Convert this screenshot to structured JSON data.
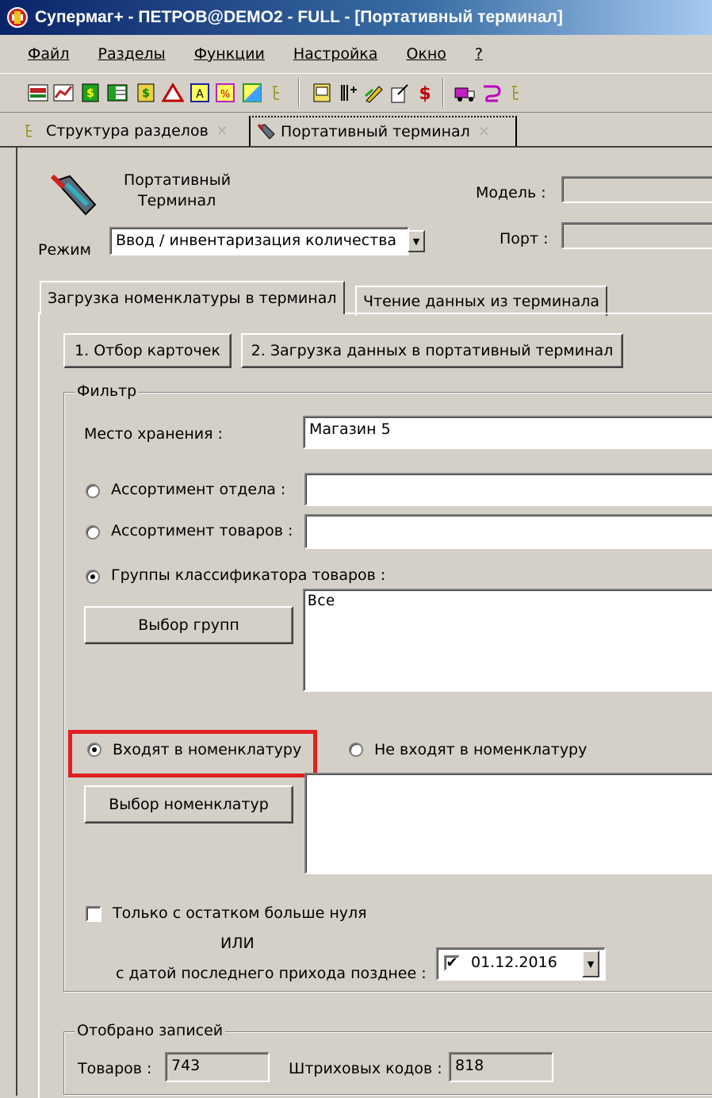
{
  "window": {
    "title": "Супермаг+ - ПЕТРОВ@DEMO2 - FULL  - [Портативный терминал]"
  },
  "menu": {
    "items": [
      "Файл",
      "Разделы",
      "Функции",
      "Настройка",
      "Окно",
      "?"
    ]
  },
  "doc_tabs": [
    {
      "label": "Структура разделов",
      "icon": "tree-icon"
    },
    {
      "label": "Портативный терминал",
      "icon": "terminal-icon"
    }
  ],
  "header": {
    "title_line1": "Портативный",
    "title_line2": "Терминал",
    "model_label": "Модель :",
    "model_value": "",
    "port_label": "Порт :",
    "port_value": "",
    "mode_label": "Режим",
    "mode_value": "Ввод / инвентаризация количества"
  },
  "tabs": {
    "load": "Загрузка номенклатуры в терминал",
    "read": "Чтение данных из терминала"
  },
  "actions": {
    "select_cards": "1. Отбор карточек",
    "load_data": "2. Загрузка данных в портативный терминал"
  },
  "filter": {
    "title": "Фильтр",
    "storage_label": "Место хранения :",
    "storage_value": "Магазин 5",
    "dept_label": "Ассортимент отдела :",
    "dept_value": "",
    "goods_label": "Ассортимент товаров :",
    "goods_value": "",
    "groups_label": "Группы классификатора товаров :",
    "groups_button": "Выбор групп",
    "groups_value": "Все",
    "in_nomen_label": "Входят в номенклатуру",
    "not_in_nomen_label": "Не входят в номенклатуру",
    "nomen_button": "Выбор номенклатур",
    "nomen_value": "",
    "stock_label": "Только с остатком больше нуля",
    "or_label": "ИЛИ",
    "date_label": "с датой последнего прихода позднее :",
    "date_value": "01.12.2016",
    "date_checked": true
  },
  "selected": {
    "title": "Отобрано записей",
    "goods_label": "Товаров :",
    "goods_count": "743",
    "barcodes_label": "Штриховых кодов :",
    "barcodes_count": "818"
  },
  "highlight_color": "#e02020"
}
